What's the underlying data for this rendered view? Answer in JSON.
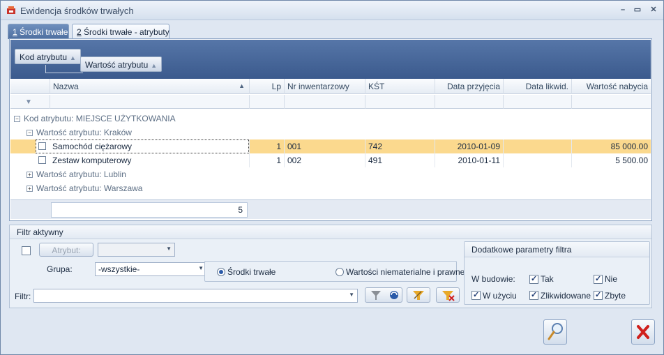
{
  "window": {
    "title": "Ewidencja środków trwałych"
  },
  "tabs": [
    {
      "num": "1",
      "label": " Środki trwałe"
    },
    {
      "num": "2",
      "label": " Środki trwałe - atrybuty"
    }
  ],
  "group_bar": {
    "chip1": "Kod atrybutu",
    "chip2": "Wartość atrybutu"
  },
  "columns": [
    "Nazwa",
    "Lp",
    "Nr inwentarzowy",
    "KŚT",
    "Data przyjęcia",
    "Data likwid.",
    "Wartość nabycia"
  ],
  "groups": {
    "level1": "Kod atrybutu: MIEJSCE UŻYTKOWANIA",
    "krakow": "Wartość atrybutu: Kraków",
    "lublin": "Wartość atrybutu: Lublin",
    "warszawa": "Wartość atrybutu: Warszawa"
  },
  "rows": [
    {
      "nazwa": "Samochód ciężarowy",
      "lp": "1",
      "nr": "001",
      "kst": "742",
      "data_przyjecia": "2010-01-09",
      "data_likwid": "",
      "wartosc": "85 000.00"
    },
    {
      "nazwa": "Zestaw komputerowy",
      "lp": "1",
      "nr": "002",
      "kst": "491",
      "data_przyjecia": "2010-01-11",
      "data_likwid": "",
      "wartosc": "5 500.00"
    }
  ],
  "footer": {
    "count": "5"
  },
  "filter_panel": {
    "header": "Filtr aktywny",
    "atrybut_btn": "Atrybut:",
    "grupa_label": "Grupa:",
    "grupa_value": "-wszystkie-",
    "radio1": "Środki trwałe",
    "radio2": "Wartości niematerialne i prawne",
    "filtr_label": "Filtr:"
  },
  "params": {
    "header": "Dodatkowe parametry filtra",
    "w_budowie": "W budowie:",
    "tak": "Tak",
    "nie": "Nie",
    "w_uzyciu": "W użyciu",
    "zlikwidowane": "Zlikwidowane",
    "zbyte": "Zbyte"
  },
  "colors": {
    "highlight": "#fbd98e",
    "accent": "#3b5a8d"
  }
}
